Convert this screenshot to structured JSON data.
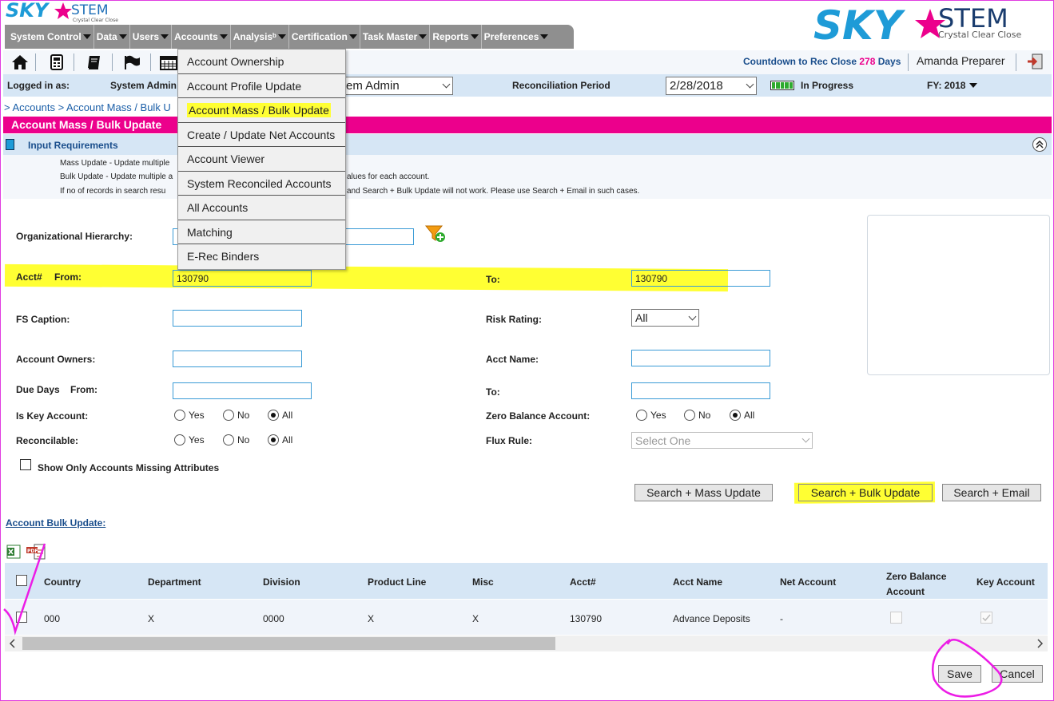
{
  "brand": {
    "name_left": "SKY",
    "name_right": "STEM",
    "tagline": "Crystal Clear Close",
    "star_color": "#ec008c",
    "blue": "#1e9bd7"
  },
  "nav": [
    {
      "label": "System Control"
    },
    {
      "label": "Data"
    },
    {
      "label": "Users"
    },
    {
      "label": "Accounts"
    },
    {
      "label": "Analysisᵇ"
    },
    {
      "label": "Certification"
    },
    {
      "label": "Task Master"
    },
    {
      "label": "Reports"
    },
    {
      "label": "Preferences"
    }
  ],
  "toolbar": {
    "icons": [
      "home-icon",
      "calculator-icon",
      "book-icon",
      "flag-icon",
      "calendar-icon"
    ],
    "countdown_label": "Countdown to Rec Close",
    "countdown_value": "278",
    "countdown_unit": "Days",
    "user_name": "Amanda Preparer"
  },
  "info": {
    "logged_in_label": "Logged in as:",
    "role_label": "System Admin",
    "role_value": "em Admin",
    "period_label": "Reconciliation Period",
    "period_value": "2/28/2018",
    "status": "In Progress",
    "fy": "FY: 2018"
  },
  "breadcrumb": "> Accounts > Account Mass / Bulk U",
  "page_title": "Account Mass / Bulk Update",
  "input_requirements": {
    "title": "Input Requirements",
    "lines": [
      "Mass Update - Update multiple",
      "Bulk Update - Update multiple a",
      "If no of records in search resu"
    ],
    "lines_right": [
      "alues for each account.",
      "and Search + Bulk Update will not work. Please use Search + Email in such cases."
    ]
  },
  "accounts_menu": [
    {
      "label": "Account Ownership",
      "highlight": false
    },
    {
      "label": "Account Profile Update",
      "highlight": false
    },
    {
      "label": "Account Mass / Bulk Update",
      "highlight": true
    },
    {
      "label": "Create / Update Net Accounts",
      "highlight": false
    },
    {
      "label": "Account Viewer",
      "highlight": false
    },
    {
      "label": "System Reconciled Accounts",
      "highlight": false
    },
    {
      "label": "All Accounts",
      "highlight": false
    },
    {
      "label": "Matching",
      "highlight": false
    },
    {
      "label": "E-Rec Binders",
      "highlight": false
    }
  ],
  "form": {
    "org_hierarchy_label": "Organizational Hierarchy:",
    "acct_from_label": "Acct#",
    "from_label": "From:",
    "acct_from_value": "130790",
    "to_label": "To:",
    "acct_to_value": "130790",
    "fs_caption_label": "FS Caption:",
    "risk_rating_label": "Risk Rating:",
    "risk_rating_value": "All",
    "account_owners_label": "Account Owners:",
    "acct_name_label": "Acct Name:",
    "due_days_label": "Due Days",
    "due_from_label": "From:",
    "due_to_label": "To:",
    "is_key_label": "Is Key Account:",
    "zero_balance_label": "Zero Balance Account:",
    "reconcilable_label": "Reconcilable:",
    "flux_rule_label": "Flux Rule:",
    "flux_rule_placeholder": "Select One",
    "radio_yes": "Yes",
    "radio_no": "No",
    "radio_all": "All",
    "show_missing_label": "Show Only Accounts Missing Attributes"
  },
  "buttons": {
    "mass_update": "Search + Mass Update",
    "bulk_update": "Search + Bulk Update",
    "email": "Search + Email",
    "save": "Save",
    "cancel": "Cancel"
  },
  "bulk_update_link": "Account Bulk Update:",
  "table": {
    "headers": [
      "Country",
      "Department",
      "Division",
      "Product Line",
      "Misc",
      "Acct#",
      "Acct Name",
      "Net Account",
      "Zero Balance Account",
      "Key Account"
    ],
    "rows": [
      [
        "000",
        "X",
        "0000",
        "X",
        "X",
        "130790",
        "Advance Deposits",
        "-"
      ]
    ]
  }
}
